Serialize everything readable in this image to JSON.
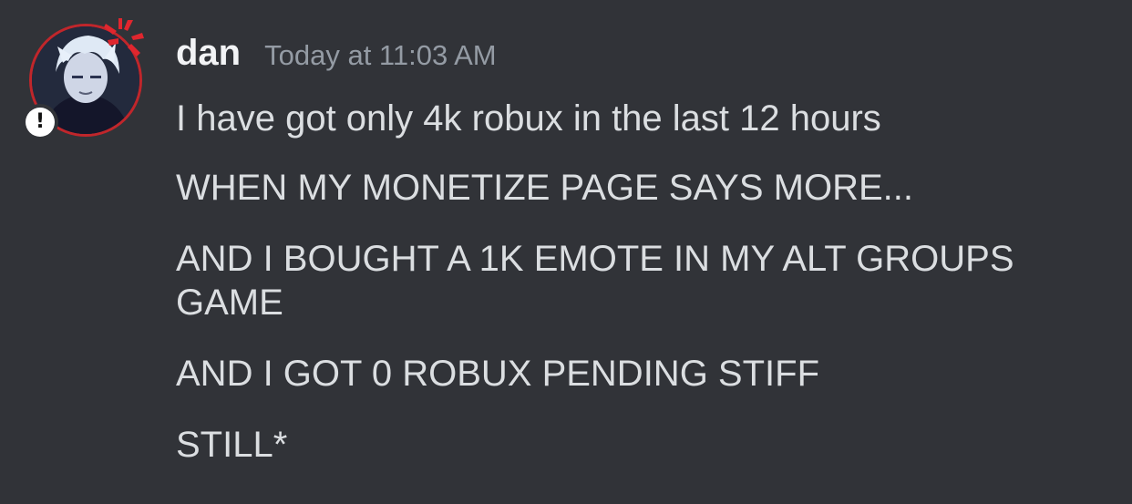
{
  "message": {
    "author": "dan",
    "timestamp": "Today at 11:03 AM",
    "lines": [
      "I have got only 4k robux in the last 12 hours",
      "WHEN MY MONETIZE PAGE SAYS MORE...",
      "AND I BOUGHT A 1K EMOTE IN MY ALT GROUPS GAME",
      "AND I GOT 0 ROBUX PENDING STIFF",
      "STILL*"
    ]
  },
  "avatar": {
    "decoration_icon": "anger-symbol-icon",
    "status_icon": "exclamation-icon",
    "status_glyph": "!",
    "ring_color": "#c0262b"
  },
  "colors": {
    "background": "#313338",
    "username": "#f2f3f5",
    "timestamp": "#949ba4",
    "text": "#dbdee1"
  }
}
